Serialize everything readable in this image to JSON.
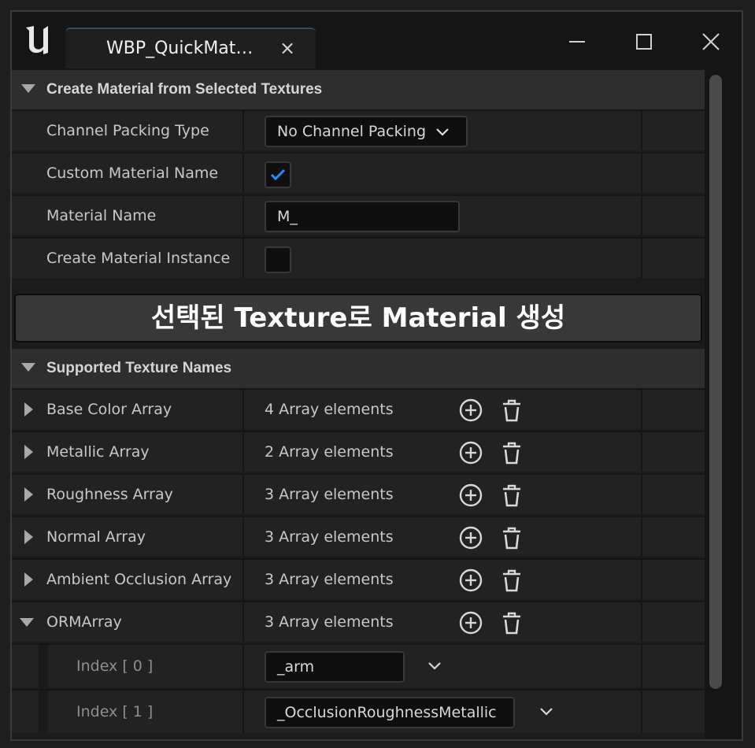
{
  "window": {
    "tab_title": "WBP_QuickMat…",
    "tab_close": "×"
  },
  "section1": {
    "title": "Create Material from Selected Textures",
    "rows": {
      "channel_packing": {
        "label": "Channel Packing Type",
        "value": "No Channel Packing"
      },
      "custom_name": {
        "label": "Custom Material Name",
        "checked": true
      },
      "material_name": {
        "label": "Material Name",
        "value": "M_"
      },
      "create_instance": {
        "label": "Create Material Instance",
        "checked": false
      }
    },
    "action_button": "선택된 Texture로 Material 생성"
  },
  "section2": {
    "title": "Supported Texture Names",
    "arrays": [
      {
        "label": "Base Color Array",
        "count": "4 Array elements",
        "expanded": false
      },
      {
        "label": "Metallic Array",
        "count": "2 Array elements",
        "expanded": false
      },
      {
        "label": "Roughness Array",
        "count": "3 Array elements",
        "expanded": false
      },
      {
        "label": "Normal Array",
        "count": "3 Array elements",
        "expanded": false
      },
      {
        "label": "Ambient Occlusion Array",
        "count": "3 Array elements",
        "expanded": false
      },
      {
        "label": "ORMArray",
        "count": "3 Array elements",
        "expanded": true
      }
    ],
    "orm_elements": [
      {
        "label": "Index [ 0 ]",
        "value": "_arm"
      },
      {
        "label": "Index [ 1 ]",
        "value": "_OcclusionRoughnessMetallic"
      }
    ]
  },
  "colors": {
    "accent": "#2a8cff",
    "panel": "#222222",
    "category": "#2e2e2e",
    "input": "#0f0f0f"
  }
}
